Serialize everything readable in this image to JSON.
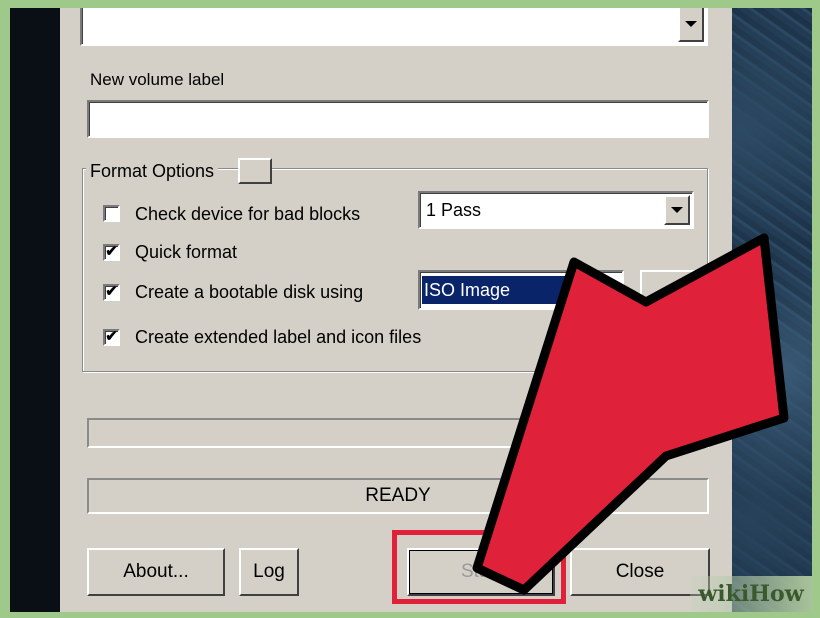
{
  "top_combo": {
    "value": ""
  },
  "volume": {
    "label": "New volume label",
    "value": ""
  },
  "format_options": {
    "title": "Format Options",
    "bad_blocks": {
      "label": "Check device for bad blocks",
      "checked": false,
      "passes": "1 Pass"
    },
    "quick_format": {
      "label": "Quick format",
      "checked": true
    },
    "bootable": {
      "label": "Create a bootable disk using",
      "checked": true,
      "type": "ISO Image"
    },
    "extended_label": {
      "label": "Create extended label and icon files",
      "checked": true
    }
  },
  "check_mark": "✔",
  "status": "READY",
  "buttons": {
    "about": "About...",
    "log": "Log",
    "start": "Start",
    "close": "Close"
  },
  "watermark": "wikiHow",
  "colors": {
    "arrow": "#e0213a",
    "highlight": "#e0213a",
    "selection": "#0a246a",
    "dialog": "#d4d0c8"
  }
}
